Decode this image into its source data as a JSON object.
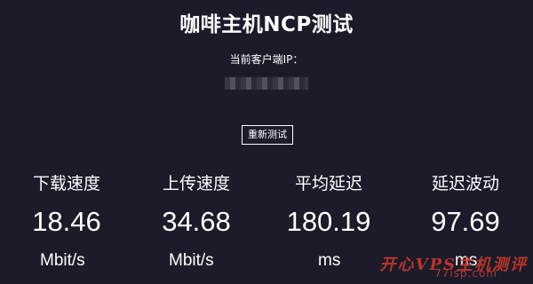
{
  "page": {
    "title": "咖啡主机NCP测试",
    "ip_label": "当前客户端IP："
  },
  "actions": {
    "retest_label": "重新测试"
  },
  "metrics": [
    {
      "label": "下载速度",
      "value": "18.46",
      "unit": "Mbit/s"
    },
    {
      "label": "上传速度",
      "value": "34.68",
      "unit": "Mbit/s"
    },
    {
      "label": "平均延迟",
      "value": "180.19",
      "unit": "ms"
    },
    {
      "label": "延迟波动",
      "value": "97.69",
      "unit": "ms"
    }
  ],
  "watermark": {
    "text": "开心VPS主机测评",
    "site": "77isp.com"
  },
  "colors": {
    "background": "#1b1b2a",
    "text": "#ffffff",
    "watermark": "#d63a2a"
  }
}
